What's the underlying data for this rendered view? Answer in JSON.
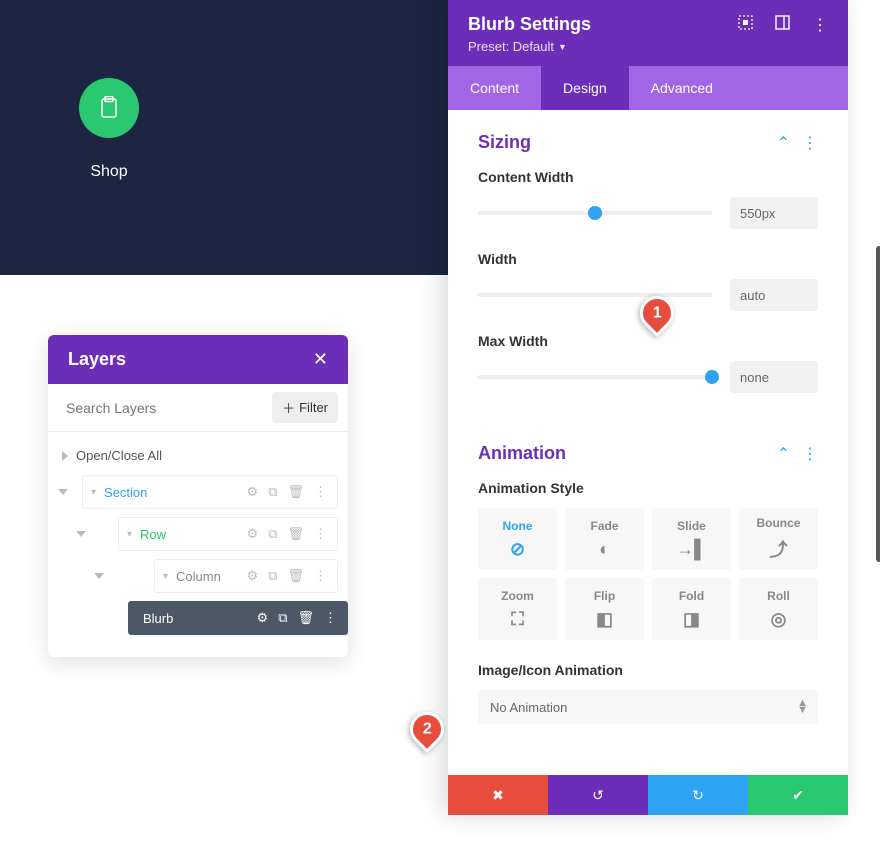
{
  "shop": {
    "label": "Shop"
  },
  "layers": {
    "title": "Layers",
    "search_placeholder": "Search Layers",
    "filter_label": "Filter",
    "open_close": "Open/Close All",
    "nodes": {
      "section": "Section",
      "row": "Row",
      "column": "Column",
      "blurb": "Blurb"
    }
  },
  "panel": {
    "title": "Blurb Settings",
    "preset": "Preset: Default",
    "tabs": {
      "content": "Content",
      "design": "Design",
      "advanced": "Advanced"
    },
    "sizing": {
      "title": "Sizing",
      "content_width": {
        "label": "Content Width",
        "value": "550px",
        "pos": 50
      },
      "width": {
        "label": "Width",
        "value": "auto",
        "pos": 0
      },
      "max_width": {
        "label": "Max Width",
        "value": "none",
        "pos": 100
      }
    },
    "animation": {
      "title": "Animation",
      "style_label": "Animation Style",
      "styles": [
        "None",
        "Fade",
        "Slide",
        "Bounce",
        "Zoom",
        "Flip",
        "Fold",
        "Roll"
      ],
      "image_label": "Image/Icon Animation",
      "image_value": "No Animation"
    }
  },
  "pins": {
    "1": "1",
    "2": "2"
  }
}
